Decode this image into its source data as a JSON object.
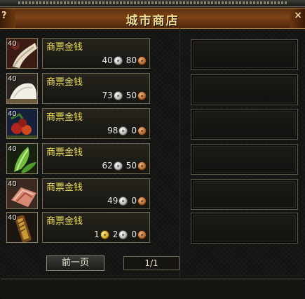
{
  "window": {
    "title": "城市商店",
    "help_label": "?",
    "close_label": "×"
  },
  "items": [
    {
      "qty": "40",
      "name": "商票金钱",
      "icon": "cloth-icon",
      "price": {
        "silver": "40",
        "copper": "80"
      }
    },
    {
      "qty": "40",
      "name": "商票金钱",
      "icon": "salt-icon",
      "price": {
        "silver": "73",
        "copper": "50"
      }
    },
    {
      "qty": "40",
      "name": "商票金钱",
      "icon": "fruit-icon",
      "price": {
        "silver": "98",
        "copper": "0"
      }
    },
    {
      "qty": "40",
      "name": "商票金钱",
      "icon": "herb-icon",
      "price": {
        "silver": "62",
        "copper": "50"
      }
    },
    {
      "qty": "40",
      "name": "商票金钱",
      "icon": "meat-icon",
      "price": {
        "silver": "49",
        "copper": "0"
      }
    },
    {
      "qty": "40",
      "name": "商票金钱",
      "icon": "scroll-icon",
      "price": {
        "gold": "1",
        "silver": "2",
        "copper": "0"
      }
    }
  ],
  "pagination": {
    "prev_label": "前一页",
    "page_text": "1/1"
  },
  "colors": {
    "title_bar": "#7d4417",
    "title_text": "#f3dc8f",
    "item_name": "#f0df5a",
    "frame_border": "#8a8060"
  }
}
